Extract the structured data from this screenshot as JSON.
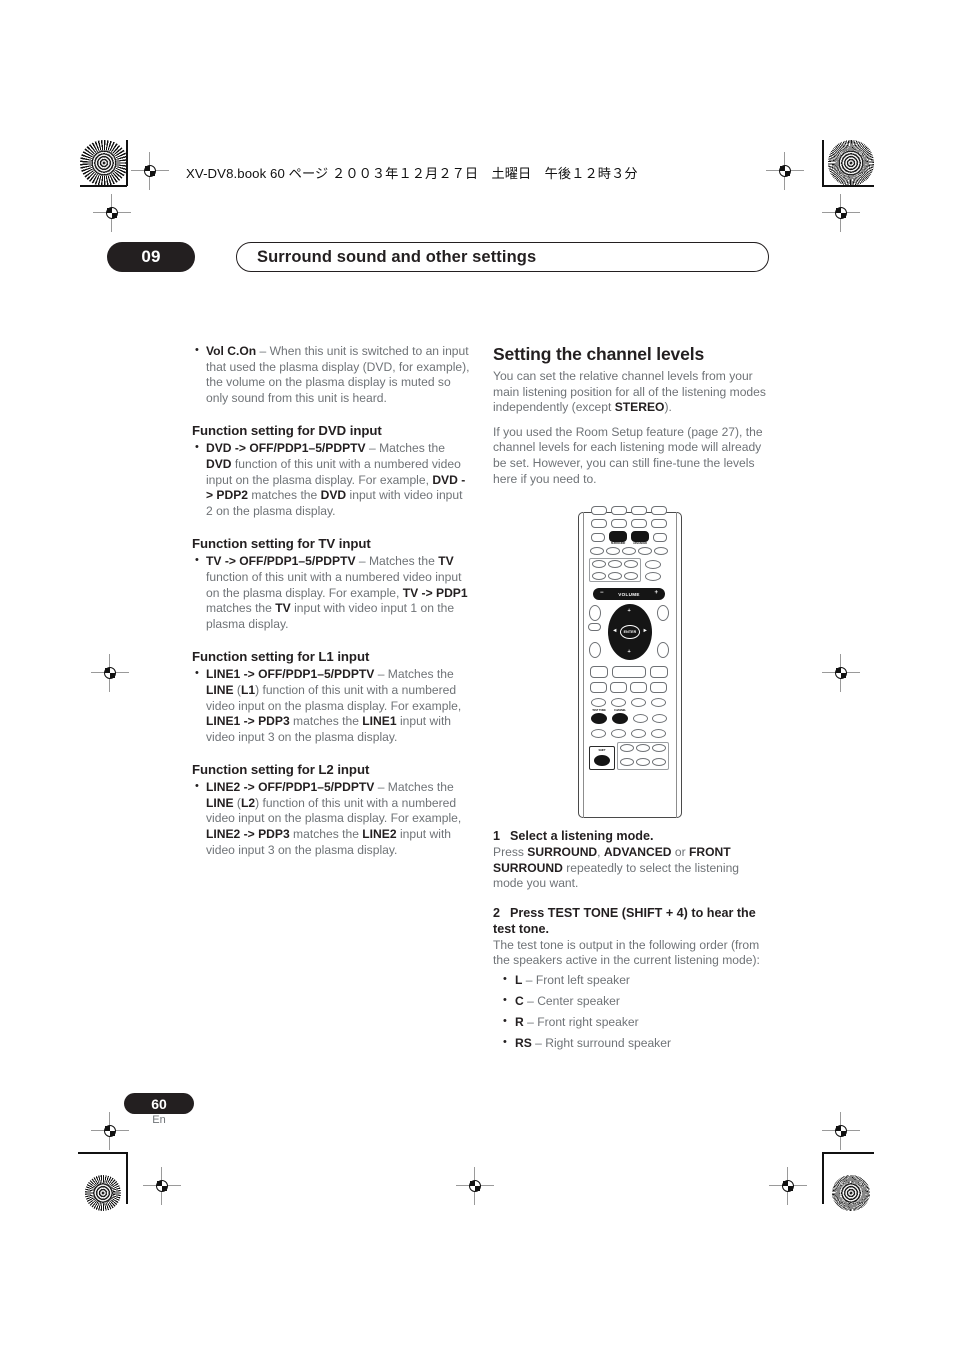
{
  "running_head": "XV-DV8.book 60 ページ ２００３年１２月２７日　土曜日　午後１２時３分",
  "chapter": {
    "number": "09",
    "title": "Surround sound and other settings"
  },
  "left_column": {
    "vol_con_bullet": {
      "term": "Vol C.On",
      "dash": " – ",
      "text": "When this unit is switched to an input that used the plasma display (DVD, for example), the volume on the plasma display is muted so only sound from this unit is heard."
    },
    "sections": [
      {
        "heading": "Function setting for DVD input",
        "bullet_term": "DVD -> OFF/PDP1–5/PDPTV",
        "bullet_body_1": " – Matches the ",
        "bullet_em_1": "DVD",
        "bullet_body_2": " function of this unit with a numbered video input on the plasma display. For example, ",
        "bullet_em_2": "DVD -> PDP2",
        "bullet_body_3": " matches the ",
        "bullet_em_3": "DVD",
        "bullet_body_4": " input with video input 2 on the plasma display."
      },
      {
        "heading": "Function setting for TV input",
        "bullet_term": "TV -> OFF/PDP1–5/PDPTV",
        "bullet_body_1": " – Matches the ",
        "bullet_em_1": "TV",
        "bullet_body_2": " function of this unit with a numbered video input on the plasma display. For example, ",
        "bullet_em_2": "TV -> PDP1",
        "bullet_body_3": " matches the ",
        "bullet_em_3": "TV",
        "bullet_body_4": " input with video input 1 on the plasma display."
      },
      {
        "heading": "Function setting for L1 input",
        "bullet_term": "LINE1 -> OFF/PDP1–5/PDPTV",
        "bullet_body_1": " – Matches the ",
        "bullet_em_1": "LINE",
        "bullet_paren_open": " (",
        "bullet_em_paren": "L1",
        "bullet_paren_close": ")",
        "bullet_body_2": " function of this unit with a numbered video input on the plasma display. For example, ",
        "bullet_em_2": "LINE1 -> PDP3",
        "bullet_body_3": " matches the ",
        "bullet_em_3": "LINE1",
        "bullet_body_4": " input with video input 3 on the plasma display."
      },
      {
        "heading": "Function setting for L2 input",
        "bullet_term": "LINE2 -> OFF/PDP1–5/PDPTV",
        "bullet_body_1": " – Matches the ",
        "bullet_em_1": "LINE",
        "bullet_paren_open": " (",
        "bullet_em_paren": "L2",
        "bullet_paren_close": ")",
        "bullet_body_2": " function of this unit with a numbered video input on the plasma display. For example, ",
        "bullet_em_2": "LINE2 -> PDP3",
        "bullet_body_3": " matches the ",
        "bullet_em_3": "LINE2",
        "bullet_body_4": " input with video input 3 on the plasma display."
      }
    ]
  },
  "right_column": {
    "heading": "Setting the channel levels",
    "para1_a": "You can set the relative channel levels from your main listening position for all of the listening modes independently (except ",
    "para1_em": "STEREO",
    "para1_b": ").",
    "para2": "If you used the Room Setup feature (page 27), the channel levels for each listening mode will already be set. However, you can still fine-tune the levels here if you need to.",
    "steps": [
      {
        "number": "1",
        "title": "Select a listening mode.",
        "body_a": "Press ",
        "body_em_1": "SURROUND",
        "body_b": ", ",
        "body_em_2": "ADVANCED",
        "body_c": " or ",
        "body_em_3": "FRONT SURROUND",
        "body_d": " repeatedly to select the listening mode you want."
      },
      {
        "number": "2",
        "title": "Press TEST TONE (SHIFT + 4) to hear the test tone.",
        "body": "The test tone is output in the following order (from the speakers active in the current listening mode):"
      }
    ],
    "speakers": [
      {
        "code": "L",
        "dash": " – ",
        "label": "Front left speaker"
      },
      {
        "code": "C",
        "dash": " – ",
        "label": "Center speaker"
      },
      {
        "code": "R",
        "dash": " – ",
        "label": "Front right speaker"
      },
      {
        "code": "RS",
        "dash": " – ",
        "label": "Right surround speaker"
      }
    ]
  },
  "remote": {
    "volume_label": "VOLUME",
    "volume_minus": "−",
    "volume_plus": "+",
    "enter_label": "ENTER",
    "up_arrow": "+",
    "down_arrow": "+",
    "left_arrow": "◄",
    "right_arrow": "►",
    "top_button_1": "SURROUND",
    "top_button_2": "ADVANCED",
    "test_tone_label": "TEST TONE",
    "channel_label": "CHANNEL",
    "shift_label": "SHIFT"
  },
  "footer": {
    "page_number": "60",
    "language": "En"
  },
  "colors": {
    "ink": "#231f20",
    "body_text": "#6f7377",
    "rule": "#4a4a4a"
  }
}
